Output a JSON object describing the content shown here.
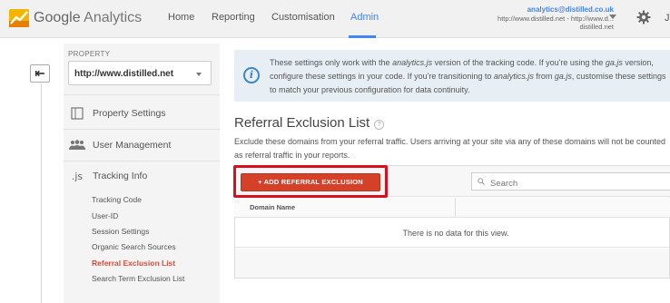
{
  "header": {
    "logo_google": "Google",
    "logo_product": "Analytics",
    "nav": [
      {
        "label": "Home"
      },
      {
        "label": "Reporting"
      },
      {
        "label": "Customisation"
      },
      {
        "label": "Admin",
        "active": true
      }
    ],
    "account": {
      "email": "analytics@distilled.co.uk",
      "line2": "http://www.distilled.net - http://www.d...",
      "line3": "distilled.net"
    },
    "overflow_text": "J"
  },
  "sidebar": {
    "property_label": "PROPERTY",
    "property_value": "http://www.distilled.net",
    "items": [
      {
        "label": "Property Settings",
        "icon": "page-icon"
      },
      {
        "label": "User Management",
        "icon": "users-icon"
      },
      {
        "label": "Tracking Info",
        "icon": "js-icon",
        "icon_text": ".js"
      }
    ],
    "subitems": [
      {
        "label": "Tracking Code"
      },
      {
        "label": "User-ID"
      },
      {
        "label": "Session Settings"
      },
      {
        "label": "Organic Search Sources"
      },
      {
        "label": "Referral Exclusion List",
        "active": true
      },
      {
        "label": "Search Term Exclusion List"
      }
    ]
  },
  "notice": {
    "part1": "These settings only work with the ",
    "em1": "analytics.js",
    "part2": " version of the tracking code. If you're using the ",
    "em2": "ga.js",
    "part3": " version, configure these settings in your code. If you're transitioning to ",
    "em3": "analytics.js",
    "part4": " from ",
    "em4": "ga.js",
    "part5": ", customise these settings to match your previous configuration for data continuity."
  },
  "main": {
    "title": "Referral Exclusion List",
    "help": "?",
    "description": "Exclude these domains from your referral traffic. Users arriving at your site via any of these domains will not be counted as referral traffic in your reports.",
    "add_button": "+ ADD REFERRAL EXCLUSION",
    "search_placeholder": "Search",
    "columns": [
      "Domain Name"
    ],
    "empty_message": "There is no data for this view."
  },
  "colors": {
    "accent": "#4285f4",
    "button": "#d54029",
    "highlight": "#d8101d",
    "active_link": "#dd4b39"
  }
}
